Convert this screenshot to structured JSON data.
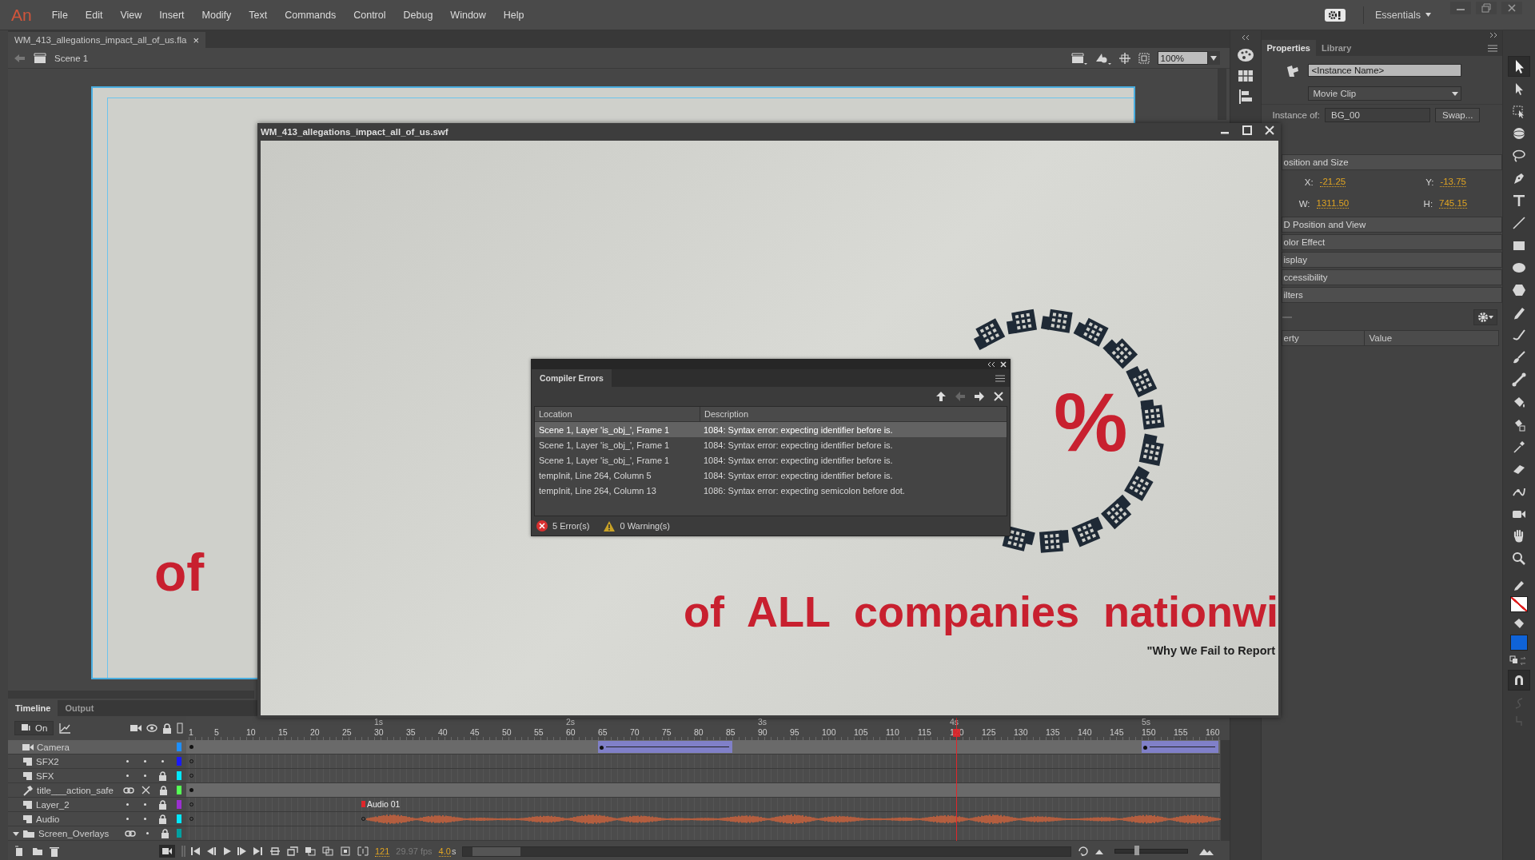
{
  "menu_bar": {
    "logo": "An",
    "items": [
      "File",
      "Edit",
      "View",
      "Insert",
      "Modify",
      "Text",
      "Commands",
      "Control",
      "Debug",
      "Window",
      "Help"
    ],
    "workspace": "Essentials"
  },
  "document_tab": {
    "title": "WM_413_allegations_impact_all_of_us.fla",
    "close": "×"
  },
  "scene_bar": {
    "scene": "Scene 1",
    "zoom": "100%"
  },
  "stage": {
    "text": "of"
  },
  "swf_window": {
    "title": "WM_413_allegations_impact_all_of_us.swf",
    "percent": "%",
    "headline": "of  ALL  companies  nationwi",
    "caption": "\"Why We Fail to Report"
  },
  "compiler_errors": {
    "title": "Compiler Errors",
    "columns": [
      "Location",
      "Description"
    ],
    "rows": [
      {
        "location": "Scene 1, Layer 'is_obj_', Frame 1",
        "description": "1084: Syntax error: expecting identifier before is.",
        "selected": true
      },
      {
        "location": "Scene 1, Layer 'is_obj_', Frame 1",
        "description": "1084: Syntax error: expecting identifier before is.",
        "selected": false
      },
      {
        "location": "Scene 1, Layer 'is_obj_', Frame 1",
        "description": "1084: Syntax error: expecting identifier before is.",
        "selected": false
      },
      {
        "location": "tempInit, Line 264, Column 5",
        "description": "1084: Syntax error: expecting identifier before is.",
        "selected": false
      },
      {
        "location": "tempInit, Line 264, Column 13",
        "description": "1086: Syntax error: expecting semicolon before dot.",
        "selected": false
      }
    ],
    "errors": "5 Error(s)",
    "warnings": "0 Warning(s)"
  },
  "properties": {
    "tabs": [
      {
        "label": "Properties",
        "selected": true
      },
      {
        "label": "Library",
        "selected": false
      }
    ],
    "instance_name": {
      "placeholder": "<Instance Name>"
    },
    "symbol_type": "Movie Clip",
    "instance_of_label": "Instance of:",
    "instance_of": "BG_00",
    "swap": "Swap...",
    "sections": [
      {
        "title": "osition and Size",
        "fields": [
          {
            "label": "X:",
            "value": "-21.25"
          },
          {
            "label": "Y:",
            "value": "-13.75"
          },
          {
            "label": "W:",
            "value": "1311.50"
          },
          {
            "label": "H:",
            "value": "745.15"
          }
        ]
      },
      {
        "title": "D Position and View"
      },
      {
        "title": "olor Effect"
      },
      {
        "title": "isplay"
      },
      {
        "title": "ccessibility"
      },
      {
        "title": "ilters"
      }
    ],
    "filter_columns": [
      "erty",
      "Value"
    ]
  },
  "tools": [
    {
      "kind": "selection",
      "selected": true
    },
    {
      "kind": "subselection",
      "selected": false
    },
    {
      "kind": "transform",
      "selected": false
    },
    {
      "kind": "rotation",
      "selected": false
    },
    {
      "kind": "lasso",
      "selected": false
    },
    {
      "kind": "pen",
      "selected": false
    },
    {
      "kind": "text",
      "selected": false
    },
    {
      "kind": "line",
      "selected": false
    },
    {
      "kind": "rectangle",
      "selected": false
    },
    {
      "kind": "oval",
      "selected": false
    },
    {
      "kind": "polystar",
      "selected": false
    },
    {
      "kind": "pencil",
      "selected": false
    },
    {
      "kind": "paintbrush",
      "selected": false
    },
    {
      "kind": "brush",
      "selected": false
    },
    {
      "kind": "bone",
      "selected": false
    },
    {
      "kind": "bucket",
      "selected": false
    },
    {
      "kind": "inkbottle",
      "selected": false
    },
    {
      "kind": "eyedropper",
      "selected": false
    },
    {
      "kind": "eraser",
      "selected": false
    },
    {
      "kind": "width",
      "selected": false
    },
    {
      "kind": "camera",
      "selected": false
    },
    {
      "kind": "hand",
      "selected": false
    },
    {
      "kind": "zoom",
      "selected": false
    }
  ],
  "swatches": [
    {
      "kind": "stroke"
    },
    {
      "kind": "fill",
      "color": "#0f63d8"
    }
  ],
  "timeline": {
    "tabs": [
      {
        "label": "Timeline",
        "selected": true
      },
      {
        "label": "Output",
        "selected": false
      }
    ],
    "onion": "On",
    "ruler_ticks": [
      "1",
      "5",
      "10",
      "15",
      "20",
      "25",
      "30",
      "35",
      "40",
      "45",
      "50",
      "55",
      "60",
      "65",
      "70",
      "75",
      "80",
      "85",
      "90",
      "95",
      "100",
      "105",
      "110",
      "115",
      "120",
      "125",
      "130",
      "135",
      "140",
      "145",
      "150",
      "155",
      "160"
    ],
    "seconds": [
      "1s",
      "2s",
      "3s",
      "4s",
      "5s"
    ],
    "layers": [
      {
        "name": "Camera",
        "kind": "camera",
        "selected": true,
        "color": "#1e8fff",
        "filled": true
      },
      {
        "name": "SFX2",
        "kind": "layer",
        "selected": false,
        "locked": false,
        "color": "#1a1aff",
        "filled": false
      },
      {
        "name": "SFX",
        "kind": "layer",
        "selected": false,
        "locked": true,
        "color": "#00e8ff",
        "filled": false
      },
      {
        "name": "title___action_safe",
        "kind": "guide",
        "selected": false,
        "locked": true,
        "color": "#55ff55",
        "filled": true
      },
      {
        "name": "Layer_2",
        "kind": "layer",
        "selected": false,
        "locked": true,
        "color": "#9b30d0",
        "filled": false,
        "label": "Audio 01"
      },
      {
        "name": "Audio",
        "kind": "layer",
        "selected": false,
        "locked": true,
        "color": "#00e8ff",
        "filled": false,
        "waveform": true
      },
      {
        "name": "Screen_Overlays",
        "kind": "folder",
        "selected": false,
        "locked": true,
        "expanded": true,
        "color": "#00a0a0",
        "filled": false
      }
    ],
    "current_frame": "121",
    "fps": "29.97 fps",
    "time": "4.0",
    "time_unit": "s",
    "zoom_slider": {
      "level": 0.3
    }
  }
}
